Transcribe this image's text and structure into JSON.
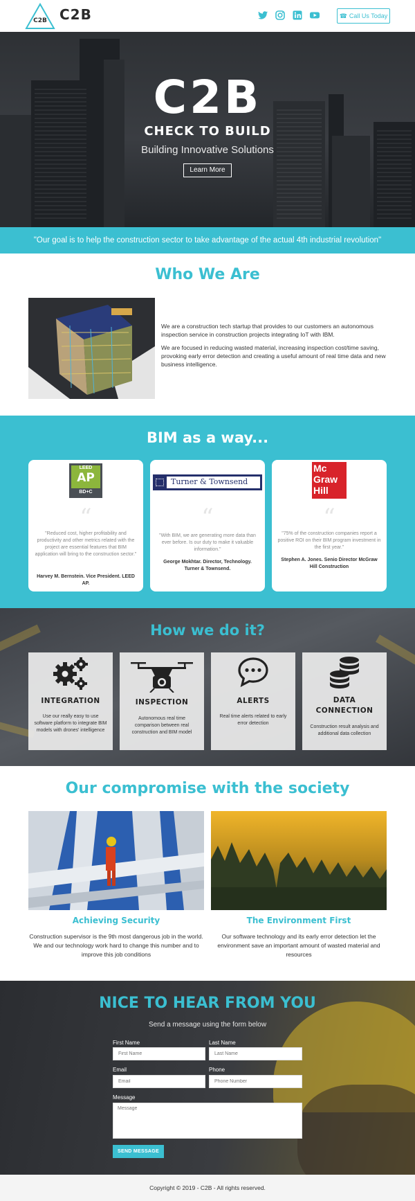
{
  "header": {
    "brand": "C2B",
    "logo_text": "C2B",
    "call_label": "Call Us Today",
    "social": [
      "twitter-icon",
      "instagram-icon",
      "linkedin-icon",
      "youtube-icon"
    ]
  },
  "hero": {
    "logo": "C2B",
    "tagline": "CHECK TO BUILD",
    "subtitle": "Building Innovative Solutions",
    "button": "Learn More"
  },
  "quote_band": "\"Our goal is to help the construction sector to take advantage of the actual 4th industrial revolution\"",
  "who": {
    "title": "Who We Are",
    "p1": "We are a construction tech startup that provides to our customers an autonomous inspection service in construction projects integrating IoT with IBM.",
    "p2": "We are focused in reducing wasted material, increasing inspection cost/time saving, provoking early error detection and creating a useful amount of real time data and new business intelligence."
  },
  "bim": {
    "title": "BIM as a way...",
    "cards": [
      {
        "logo_lines": [
          "LEED",
          "AP",
          "BD+C"
        ],
        "quote": "\"Reduced cost, higher profitability and productivity and other metrics related with the project are essential features that BIM application will bring to the construction sector.\"",
        "author": "Harvey M. Bernstein. Vice President. LEED AP."
      },
      {
        "logo_lines": [
          "Turner & Townsend"
        ],
        "quote": "\"With BIM, we are generating more data than ever before. Is our duty to make it valuable information.\"",
        "author": "George Mokhtar. Director, Technology. Turner & Townsend."
      },
      {
        "logo_lines": [
          "Mc",
          "Graw",
          "Hill"
        ],
        "quote": "\"75% of the construction companies report a positive ROI on their BIM program investment in the first year.\"",
        "author": "Stephen A. Jones. Senio Director McGraw Hill Construction"
      }
    ]
  },
  "how": {
    "title": "How we do it?",
    "cards": [
      {
        "icon": "gears-icon",
        "title": "INTEGRATION",
        "desc": "Use our really easy to use software platform to integrate BIM models with drones' intelligence"
      },
      {
        "icon": "drone-icon",
        "title": "INSPECTION",
        "desc": "Autonomous real time comparison between real construction and BIM model"
      },
      {
        "icon": "chat-bubble-icon",
        "title": "ALERTS",
        "desc": "Real time alerts related to early error detection"
      },
      {
        "icon": "database-icon",
        "title_1": "DATA",
        "title_2": "CONNECTION",
        "desc": "Construction result analysis and additional data collection"
      }
    ]
  },
  "compromise": {
    "title": "Our compromise with the society",
    "left": {
      "title": "Achieving Security",
      "desc": "Construction supervisor is the 9th most dangerous job in the world. We and our technology work hard to change this number and to improve this job conditions"
    },
    "right": {
      "title": "The Environment First",
      "desc": "Our software technology and its early error detection let the environment save an important amount of wasted material and resources"
    }
  },
  "contact": {
    "title": "NICE TO HEAR FROM YOU",
    "subtitle": "Send a message using the form below",
    "first_name_label": "First Name",
    "first_name_placeholder": "First Name",
    "last_name_label": "Last Name",
    "last_name_placeholder": "Last Name",
    "email_label": "Email",
    "email_placeholder": "Email",
    "phone_label": "Phone",
    "phone_placeholder": "Phone Number",
    "message_label": "Message",
    "message_placeholder": "Message",
    "send": "SEND MESSAGE"
  },
  "footer": "Copyright © 2019 - C2B - All rights reserved.",
  "colors": {
    "accent": "#3bbfd1",
    "dark": "#2b2d31"
  }
}
